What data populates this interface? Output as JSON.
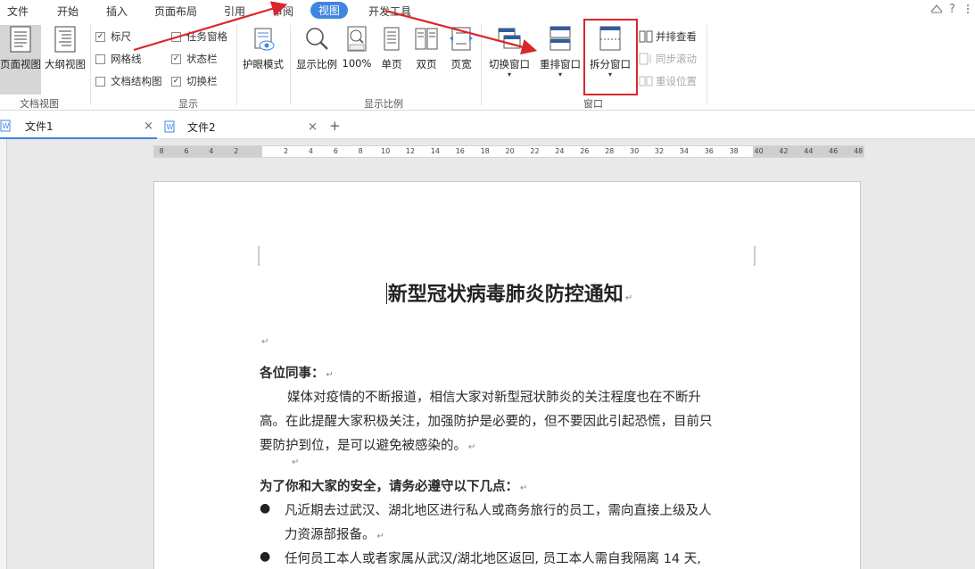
{
  "menu": {
    "file": "文件",
    "home": "开始",
    "insert": "插入",
    "layout": "页面布局",
    "references": "引用",
    "review": "审阅",
    "view": "视图",
    "developer": "开发工具",
    "help_icon": "?"
  },
  "ribbon": {
    "doc_view": {
      "page_view": "页面视图",
      "outline_view": "大纲视图",
      "group": "文档视图"
    },
    "show": {
      "ruler": "标尺",
      "gridlines": "网格线",
      "doc_map": "文档结构图",
      "task_pane": "任务窗格",
      "status_bar": "状态栏",
      "tab_bar": "切换栏",
      "group": "显示"
    },
    "eye_mode": "护眼模式",
    "zoom": {
      "zoom": "显示比例",
      "hundred": "100%",
      "one_page": "单页",
      "two_pages": "双页",
      "page_width": "页宽",
      "group": "显示比例"
    },
    "window": {
      "switch": "切换窗口",
      "arrange": "重排窗口",
      "split": "拆分窗口",
      "side_by_side": "并排查看",
      "sync_scroll": "同步滚动",
      "reset_pos": "重设位置",
      "group": "窗口"
    }
  },
  "tabs": [
    {
      "label": "文件1",
      "close": "×"
    },
    {
      "label": "文件2",
      "close": "×"
    }
  ],
  "add_tab": "+",
  "ruler": {
    "ticks": [
      "8",
      "6",
      "4",
      "2",
      "",
      "2",
      "4",
      "6",
      "8",
      "10",
      "12",
      "14",
      "16",
      "18",
      "20",
      "22",
      "24",
      "26",
      "28",
      "30",
      "32",
      "34",
      "36",
      "38",
      "40",
      "42",
      "44",
      "46",
      "48"
    ]
  },
  "document": {
    "title": "新型冠状病毒肺炎防控通知",
    "greeting": "各位同事：",
    "p1_l1": "媒体对疫情的不断报道，相信大家对新型冠状肺炎的关注程度也在不断升",
    "p1_l2": "高。在此提醒大家积极关注，加强防护是必要的，但不要因此引起恐慌，目前只",
    "p1_l3": "要防护到位，是可以避免被感染的。",
    "heading2": "为了你和大家的安全，请务必遵守以下几点：",
    "b1_l1": "凡近期去过武汉、湖北地区进行私人或商务旅行的员工，需向直接上级及人",
    "b1_l2": "力资源部报备。",
    "b2_l1": "任何员工本人或者家属从武汉/湖北地区返回, 员工本人需自我隔离  14  天,",
    "para_mark": "↵"
  }
}
